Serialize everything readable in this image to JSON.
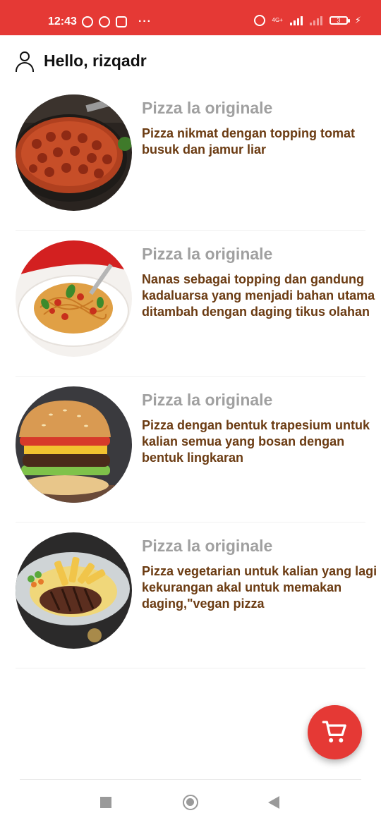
{
  "status_bar": {
    "time": "12:43",
    "dots": "···",
    "network_label": "4G+",
    "battery_level": "3",
    "background_color": "#e53935"
  },
  "header": {
    "greeting": "Hello, rizqadr",
    "icon": "user-icon"
  },
  "menu_items": [
    {
      "title": "Pizza la originale",
      "description": "Pizza nikmat dengan topping tomat busuk dan jamur liar",
      "image": "pepperoni-pizza"
    },
    {
      "title": "Pizza la originale",
      "description": "Nanas sebagai topping dan gandung kadaluarsa yang menjadi bahan utama ditambah dengan daging tikus olahan",
      "image": "spaghetti"
    },
    {
      "title": "Pizza la originale",
      "description": "Pizza dengan bentuk trapesium untuk kalian semua yang bosan dengan bentuk lingkaran",
      "image": "burger"
    },
    {
      "title": "Pizza la originale",
      "description": "Pizza vegetarian untuk kalian yang lagi kekurangan akal untuk memakan daging,\"vegan pizza",
      "image": "steak-with-fries"
    }
  ],
  "cart_button": {
    "icon": "cart-icon",
    "color": "#e53935"
  },
  "colors": {
    "title_gray": "#a0a0a0",
    "description_brown": "#6b3b12"
  }
}
